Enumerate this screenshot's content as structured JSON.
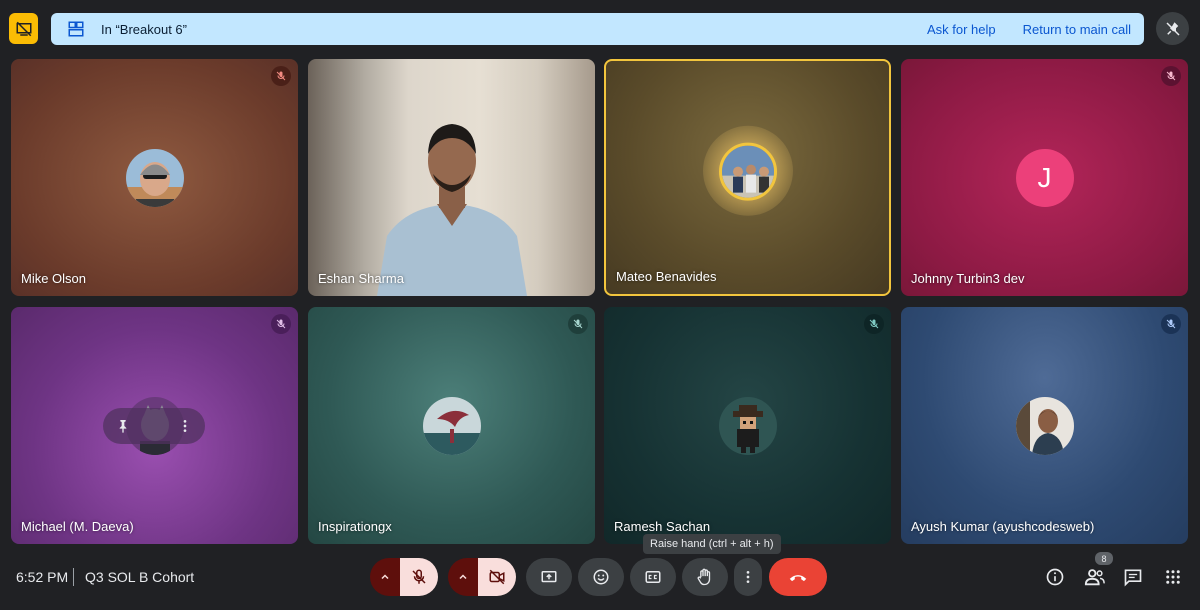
{
  "breakout": {
    "title": "In “Breakout 6”",
    "ask_help": "Ask for help",
    "return_main": "Return to main call"
  },
  "tiles": [
    {
      "name": "Mike Olson",
      "muted": true,
      "type": "avatar-photo"
    },
    {
      "name": "Eshan Sharma",
      "muted": false,
      "type": "video"
    },
    {
      "name": "Mateo Benavides",
      "muted": false,
      "type": "avatar-speaking"
    },
    {
      "name": "Johnny Turbin3 dev",
      "muted": true,
      "type": "letter",
      "letter": "J"
    },
    {
      "name": "Michael (M. Daeva)",
      "muted": true,
      "type": "avatar-hover"
    },
    {
      "name": "Inspirationgx",
      "muted": true,
      "type": "avatar-photo"
    },
    {
      "name": "Ramesh Sachan",
      "muted": true,
      "type": "avatar-photo"
    },
    {
      "name": "Ayush Kumar (ayushcodesweb)",
      "muted": true,
      "type": "avatar-photo"
    }
  ],
  "tooltip": "Raise hand (ctrl + alt + h)",
  "footer": {
    "time": "6:52 PM",
    "meeting_name": "Q3 SOL B Cohort",
    "people_count": "8"
  },
  "colors": {
    "breakout_bg": "#c2e7ff",
    "link": "#0b57d0",
    "end_call": "#ea4335",
    "active_speaker_border": "#f2c53d",
    "letter_avatar": "#ec407a"
  },
  "icons": {
    "top_left": "presentation-off-icon",
    "breakout": "breakout-rooms-icon",
    "top_right": "pin-off-icon"
  }
}
